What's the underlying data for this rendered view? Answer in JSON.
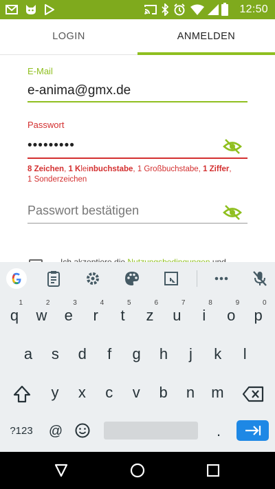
{
  "status_bar": {
    "time": "12:50",
    "left_icons": [
      "email-icon",
      "cat-icon",
      "play-store-icon"
    ],
    "right_icons": [
      "cast-icon",
      "bluetooth-icon",
      "alarm-icon",
      "wifi-icon",
      "signal-icon",
      "battery-icon"
    ],
    "bg_color": "#7faa1d"
  },
  "tabs": {
    "login": "LOGIN",
    "register": "ANMELDEN",
    "active": "register"
  },
  "form": {
    "email": {
      "label": "E-Mail",
      "value": "e-anima@gmx.de"
    },
    "password": {
      "label": "Passwort",
      "value": "•••••••••",
      "hint": {
        "p1": "8 Zeichen",
        "s1": ", ",
        "p2": "1 K",
        "p3": "lei",
        "p4": "nbuchstabe",
        "s2": ", ",
        "p5": "1 Großbuchstabe",
        "s3": ", ",
        "p6": "1 Ziffer",
        "s4": ",",
        "p7": "1 Sonderzeichen"
      }
    },
    "confirm": {
      "placeholder": "Passwort bestätigen"
    },
    "terms": {
      "prefix": "Ich akzeptiere die ",
      "link": "Nutzungsbedingungen",
      "suffix": " und"
    }
  },
  "colors": {
    "accent": "#8fbf1f",
    "error": "#d32f2f",
    "keyboard_bg": "#eceff1",
    "enter_key": "#1e88e5"
  },
  "keyboard": {
    "toolbar": [
      "google-icon",
      "clipboard-icon",
      "settings-icon",
      "palette-icon",
      "screenshot-icon",
      "more-icon",
      "mic-off-icon"
    ],
    "row1": [
      {
        "k": "q",
        "s": "1"
      },
      {
        "k": "w",
        "s": "2"
      },
      {
        "k": "e",
        "s": "3"
      },
      {
        "k": "r",
        "s": "4"
      },
      {
        "k": "t",
        "s": "5"
      },
      {
        "k": "z",
        "s": "6"
      },
      {
        "k": "u",
        "s": "7"
      },
      {
        "k": "i",
        "s": "8"
      },
      {
        "k": "o",
        "s": "9"
      },
      {
        "k": "p",
        "s": "0"
      }
    ],
    "row2": [
      "a",
      "s",
      "d",
      "f",
      "g",
      "h",
      "j",
      "k",
      "l"
    ],
    "row3": [
      "y",
      "x",
      "c",
      "v",
      "b",
      "n",
      "m"
    ],
    "row4": {
      "symbols": "?123",
      "at": "@",
      "period": "."
    }
  },
  "nav_bar": [
    "back-icon",
    "home-icon",
    "recents-icon"
  ]
}
